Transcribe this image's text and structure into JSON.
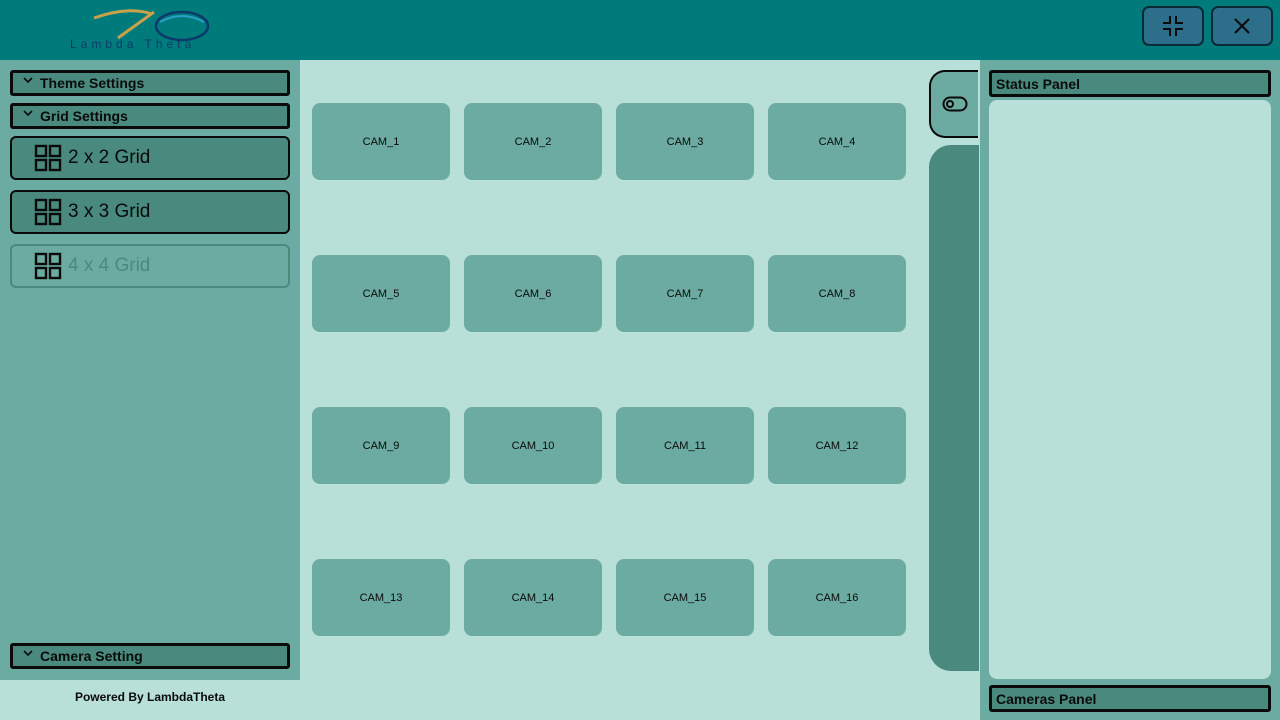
{
  "header": {
    "logo_text": "Lambda Theta",
    "minimize_icon": "compress-icon",
    "close_icon": "close-icon"
  },
  "left_panel": {
    "theme_settings_label": "Theme Settings",
    "grid_settings_label": "Grid Settings",
    "grid_options": [
      {
        "label": "2 x 2 Grid",
        "state": "enabled"
      },
      {
        "label": "3 x 3 Grid",
        "state": "enabled"
      },
      {
        "label": "4 x 4 Grid",
        "state": "selected-disabled"
      }
    ],
    "camera_setting_label": "Camera Setting",
    "footer": "Powered By LambdaTheta"
  },
  "cameras": [
    "CAM_1",
    "CAM_2",
    "CAM_3",
    "CAM_4",
    "CAM_5",
    "CAM_6",
    "CAM_7",
    "CAM_8",
    "CAM_9",
    "CAM_10",
    "CAM_11",
    "CAM_12",
    "CAM_13",
    "CAM_14",
    "CAM_15",
    "CAM_16"
  ],
  "right_panel": {
    "status_panel_label": "Status Panel",
    "cameras_panel_label": "Cameras Panel"
  },
  "colors": {
    "header": "#007b7b",
    "panel": "#6caba1",
    "panel_dark": "#4a8a7e",
    "background": "#b8dfd8"
  }
}
